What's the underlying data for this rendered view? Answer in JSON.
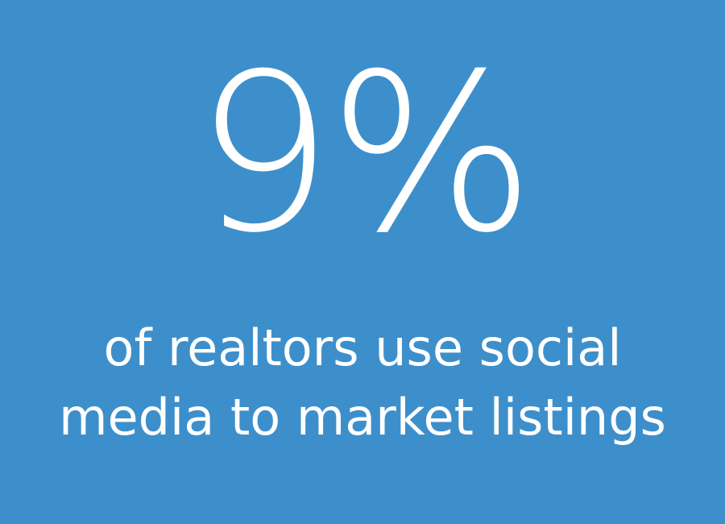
{
  "stat": {
    "value": "9%",
    "caption_lines": [
      "of realtors use social",
      "media to market listings"
    ]
  },
  "colors": {
    "background": "#3d8fcb",
    "text": "#ffffff"
  }
}
